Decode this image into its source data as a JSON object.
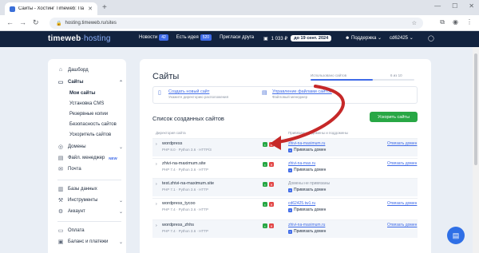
{
  "browser": {
    "tab_title": "Сайты - Хостинг Timeweb: Па",
    "url": "hosting.timeweb.ru/sites",
    "tab_close_glyph": "✕",
    "new_tab_glyph": "+",
    "icons": [
      "back-icon",
      "forward-icon",
      "reload-icon",
      "star-icon",
      "extensions-icon",
      "profile-icon",
      "menu-icon"
    ]
  },
  "header": {
    "logo_bold": "timeweb",
    "logo_light": "hosting",
    "news_label": "Новости",
    "news_count": "42",
    "ideas_label": "Есть идея",
    "ideas_count": "520",
    "invite_label": "Пригласи друга",
    "balance": "1 033 ₽",
    "paid_until": "до 19 сент. 2024",
    "support_label": "Поддержка",
    "account": "cd62425"
  },
  "sidebar": {
    "dashboard": "Дашборд",
    "sites": "Сайты",
    "sub": [
      "Мои сайты",
      "Установка CMS",
      "Резервные копии",
      "Безопасность сайтов",
      "Ускоритель сайтов"
    ],
    "domains": "Домены",
    "file_manager": "Файл. менеджер",
    "file_manager_badge": "NEW",
    "mail": "Почта",
    "databases": "Базы данных",
    "tools": "Инструменты",
    "account": "Аккаунт",
    "payment": "Оплата",
    "balance_payments": "Баланс и платежи"
  },
  "main": {
    "title": "Сайты",
    "usage_label": "Использовано сайтов",
    "usage_count": "6 из 10",
    "usage_fraction": 0.6,
    "create_site_label": "Создать новый сайт",
    "create_site_sub": "Укажите директорию расположения",
    "file_manage_label": "Управление файлами сайтов",
    "file_manage_sub": "Файловый менеджер",
    "list_title": "Список созданных сайтов",
    "accelerate_button": "Ускорить сайты",
    "col_dir": "Директория сайта",
    "col_domains": "Привязанные домены и поддомены",
    "bind_domain": "Привязать домен",
    "unbind_domain": "Отвязать домен",
    "sites": [
      {
        "name": "wordpress",
        "meta": "PHP 8.0 · Python 3.6 · HTTP/3",
        "domain": "zhivi-na-maximum.ru",
        "domain_grey": false,
        "unbind": true
      },
      {
        "name": "zhivi-na-maximum.site",
        "meta": "PHP 7.4 · Python 3.6 · HTTP",
        "domain": "zhivi-na-max.ru",
        "domain_grey": false,
        "unbind": true
      },
      {
        "name": "test.zhivi-na-maximum.site",
        "meta": "PHP 7.1 · Python 3.6 · HTTP",
        "domain": "Домены не привязаны",
        "domain_grey": true,
        "unbind": false
      },
      {
        "name": "wordpress_tycoo",
        "meta": "PHP 7.4 · Python 3.6 · HTTP",
        "domain": "cd62425.tw1.ru",
        "domain_grey": false,
        "unbind": true
      },
      {
        "name": "wordpress_zhhs",
        "meta": "PHP 7.4 · Python 3.6 · HTTP",
        "domain": "zhivi-na-maximum.ru",
        "domain_grey": false,
        "unbind": true
      }
    ]
  },
  "colors": {
    "topbar": "#12233f",
    "accent": "#3f6be8",
    "green": "#28a745",
    "red": "#e24545",
    "annotation_arrow": "#c62828"
  }
}
